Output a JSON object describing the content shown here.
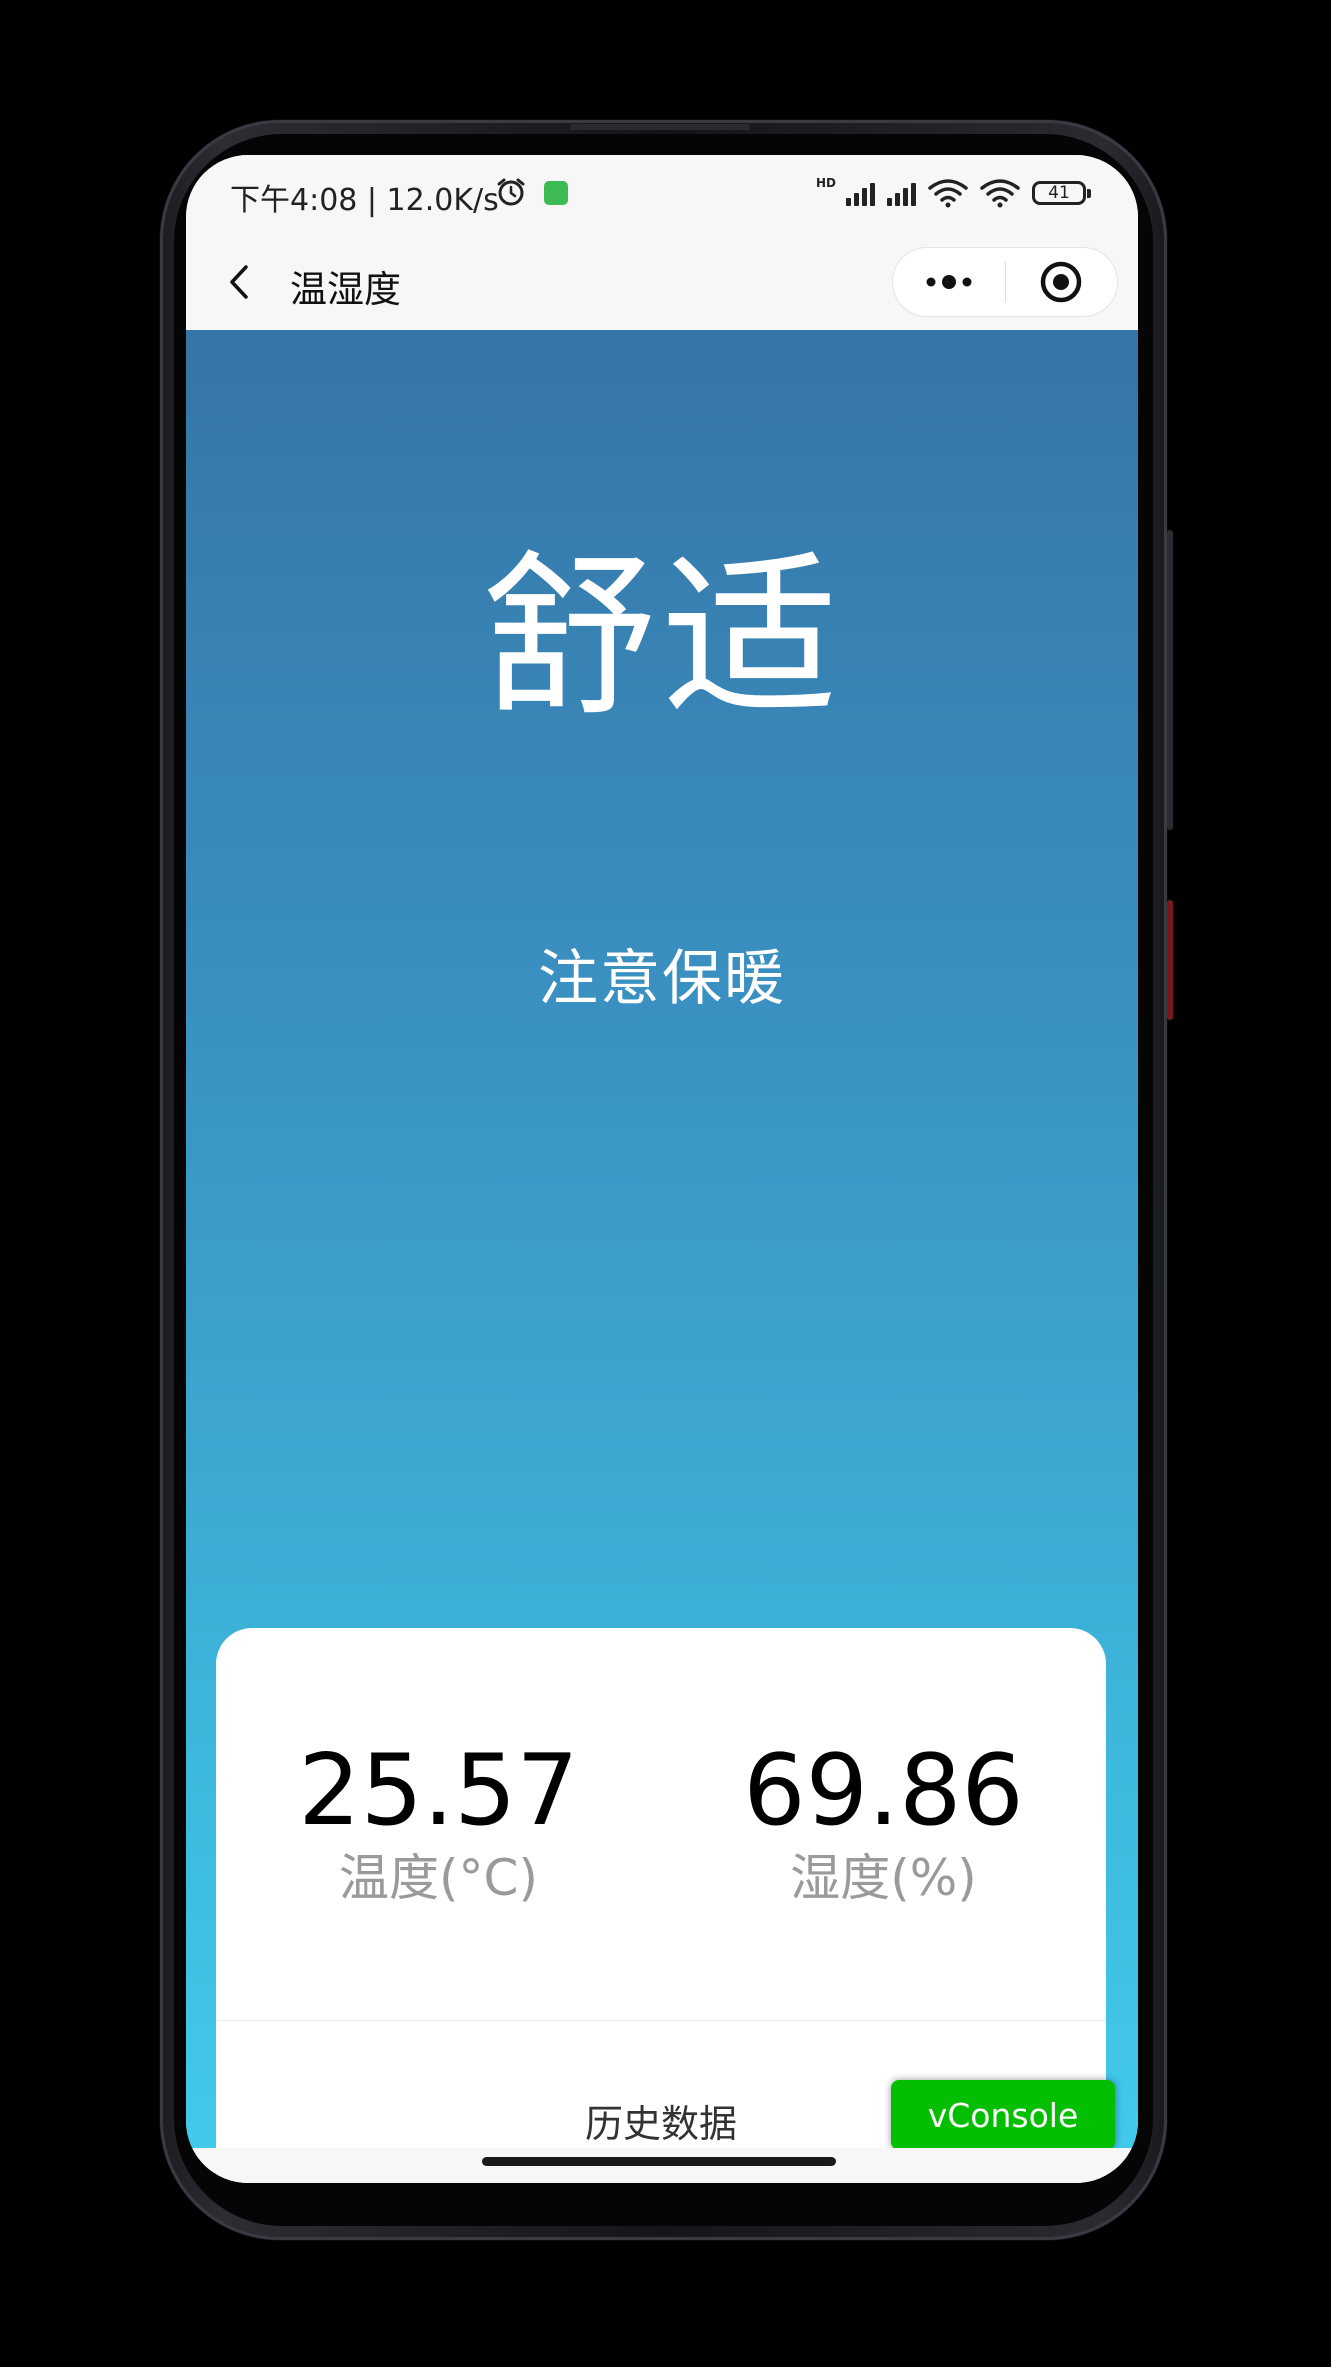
{
  "status_bar": {
    "time_net": "下午4:08 | 12.0K/s",
    "hd_label": "HD",
    "battery": "41",
    "icons": [
      "alarm-icon",
      "app-notification-icon",
      "signal-icon",
      "signal-icon",
      "wifi-icon",
      "wifi-icon",
      "battery-icon"
    ]
  },
  "navbar": {
    "title": "温湿度",
    "back_icon": "chevron-left-icon",
    "more_icon": "more-dots-icon",
    "close_icon": "target-circle-icon"
  },
  "comfort": {
    "title": "舒适",
    "subtitle": "注意保暖"
  },
  "card": {
    "temperature": {
      "value": "25.57",
      "label": "温度(°C)"
    },
    "humidity": {
      "value": "69.86",
      "label": "湿度(%)"
    },
    "history_label": "历史数据"
  },
  "vconsole": {
    "label": "vConsole"
  },
  "colors": {
    "gradient_top": "#3675a8",
    "gradient_bottom": "#41c9eb",
    "vconsole_green": "#04be02",
    "app_icon_green": "#3cba54"
  }
}
